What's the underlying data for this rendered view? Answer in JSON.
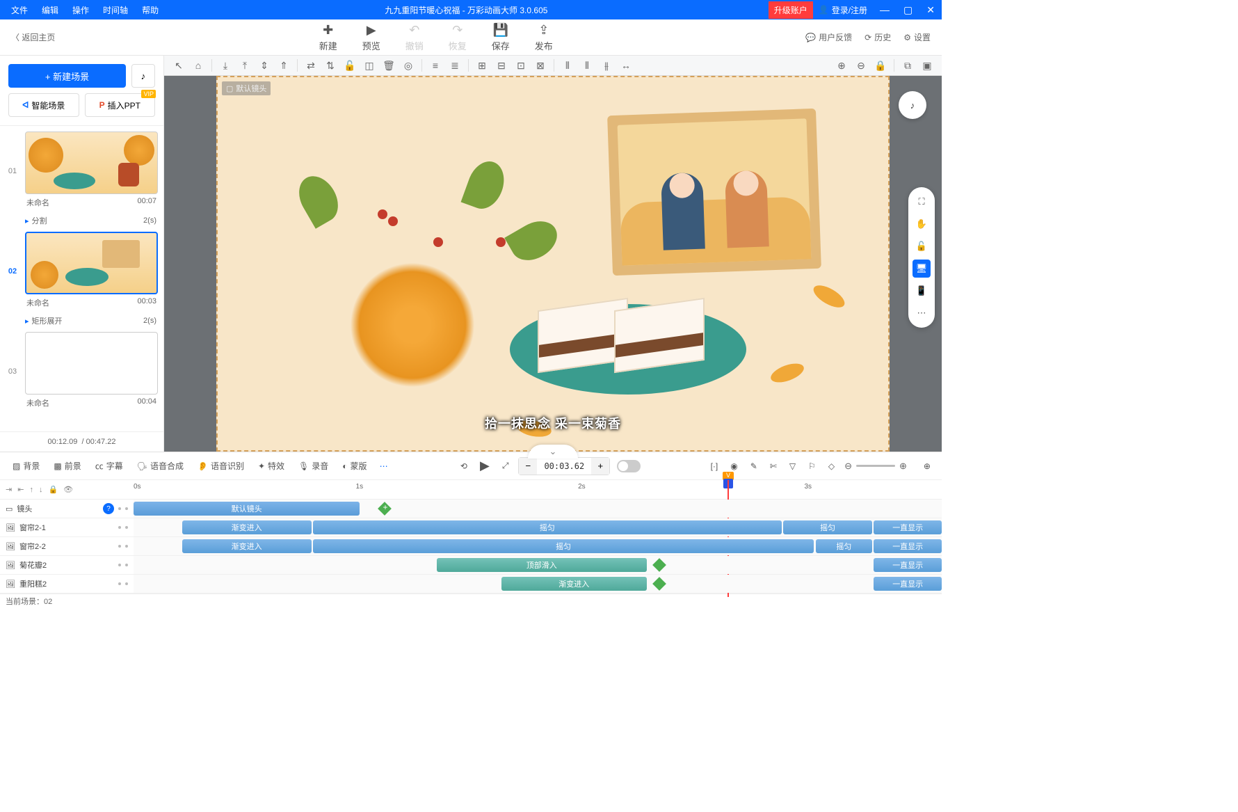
{
  "titlebar": {
    "menus": [
      "文件",
      "编辑",
      "操作",
      "时间轴",
      "帮助"
    ],
    "document_title": "九九重阳节暖心祝福 - 万彩动画大师 3.0.605",
    "upgrade": "升级账户",
    "login": "登录/注册"
  },
  "toolbar": {
    "back_home": "返回主页",
    "actions": {
      "new": "新建",
      "preview": "预览",
      "undo": "撤销",
      "redo": "恢复",
      "save": "保存",
      "publish": "发布"
    },
    "right": {
      "feedback": "用户反馈",
      "history": "历史",
      "settings": "设置"
    }
  },
  "sidebar": {
    "new_scene": "+ 新建场景",
    "smart_scene": "智能场景",
    "insert_ppt": "插入PPT",
    "vip": "VIP",
    "scenes": [
      {
        "num": "01",
        "name": "未命名",
        "duration": "00:07",
        "transition": "分割",
        "trans_time": "2(s)"
      },
      {
        "num": "02",
        "name": "未命名",
        "duration": "00:03",
        "transition": "矩形展开",
        "trans_time": "2(s)"
      },
      {
        "num": "03",
        "name": "未命名",
        "duration": "00:04"
      }
    ],
    "time_current": "00:12.09",
    "time_total": "/ 00:47.22"
  },
  "canvas": {
    "camera_label": "默认镜头",
    "subtitle": "拾一抹思念 采一束菊香"
  },
  "timeline": {
    "tools": {
      "background": "背景",
      "foreground": "前景",
      "subtitle": "字幕",
      "tts": "语音合成",
      "asr": "语音识别",
      "effects": "特效",
      "record": "录音",
      "mask": "蒙版"
    },
    "time_display": "00:03.62",
    "ruler": [
      "0s",
      "1s",
      "2s",
      "3s"
    ],
    "tracks": [
      {
        "icon": "video",
        "name": "镜头",
        "help": true
      },
      {
        "icon": "image",
        "name": "窗帘2-1"
      },
      {
        "icon": "image",
        "name": "窗帘2-2"
      },
      {
        "icon": "image",
        "name": "菊花瓣2"
      },
      {
        "icon": "image",
        "name": "重阳糕2"
      }
    ],
    "clips": {
      "camera_default": "默认镜头",
      "fade_in": "渐变进入",
      "shake": "摇匀",
      "always_show": "一直显示",
      "top_in": "顶部滑入"
    }
  },
  "status": {
    "current_scene": "当前场景：02"
  }
}
